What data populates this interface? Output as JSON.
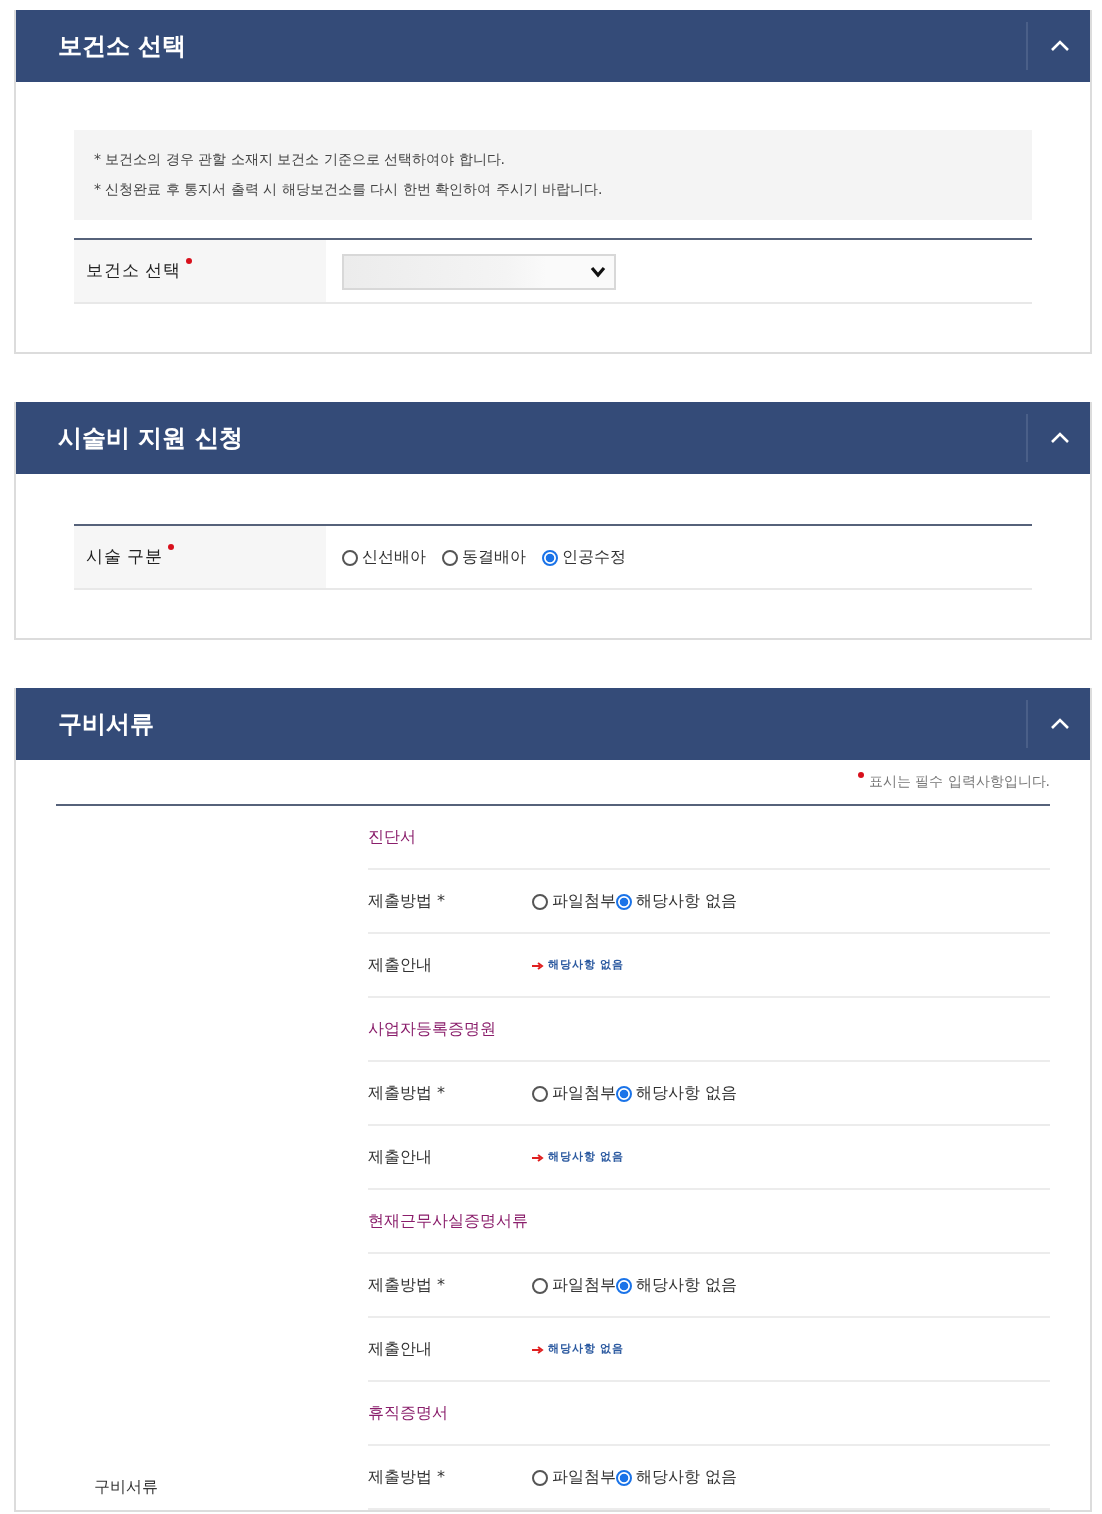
{
  "panels": [
    {
      "kind": "clinic",
      "title": "보건소 선택",
      "expanded": true,
      "notes": [
        "* 보건소의 경우 관할 소재지 보건소 기준으로 선택하여야 합니다.",
        "* 신청완료 후 통지서 출력 시 해당보건소를 다시 한번 확인하여 주시기 바랍니다."
      ],
      "field": {
        "label": "보건소 선택",
        "required": true
      }
    },
    {
      "kind": "procedure",
      "title": "시술비 지원 신청",
      "expanded": true,
      "field": {
        "label": "시술 구분",
        "required": true,
        "options": [
          {
            "label": "신선배아",
            "selected": false
          },
          {
            "label": "동결배아",
            "selected": false
          },
          {
            "label": "인공수정",
            "selected": true
          }
        ]
      }
    },
    {
      "kind": "documents",
      "title": "구비서류",
      "expanded": true,
      "required_note": "표시는 필수 입력사항입니다.",
      "group_label": "구비서류",
      "documents": [
        {
          "title": "진단서",
          "method_label": "제출방법 *",
          "options": [
            {
              "label": "파일첨부",
              "selected": false
            },
            {
              "label": "해당사항 없음",
              "selected": true
            }
          ],
          "guide_label": "제출안내",
          "guide": "해당사항 없음"
        },
        {
          "title": "사업자등록증명원",
          "method_label": "제출방법 *",
          "options": [
            {
              "label": "파일첨부",
              "selected": false
            },
            {
              "label": "해당사항 없음",
              "selected": true
            }
          ],
          "guide_label": "제출안내",
          "guide": "해당사항 없음"
        },
        {
          "title": "현재근무사실증명서류",
          "method_label": "제출방법 *",
          "options": [
            {
              "label": "파일첨부",
              "selected": false
            },
            {
              "label": "해당사항 없음",
              "selected": true
            }
          ],
          "guide_label": "제출안내",
          "guide": "해당사항 없음"
        },
        {
          "title": "휴직증명서",
          "method_label": "제출방법 *",
          "options": [
            {
              "label": "파일첨부",
              "selected": false
            },
            {
              "label": "해당사항 없음",
              "selected": true
            }
          ]
        }
      ]
    }
  ]
}
